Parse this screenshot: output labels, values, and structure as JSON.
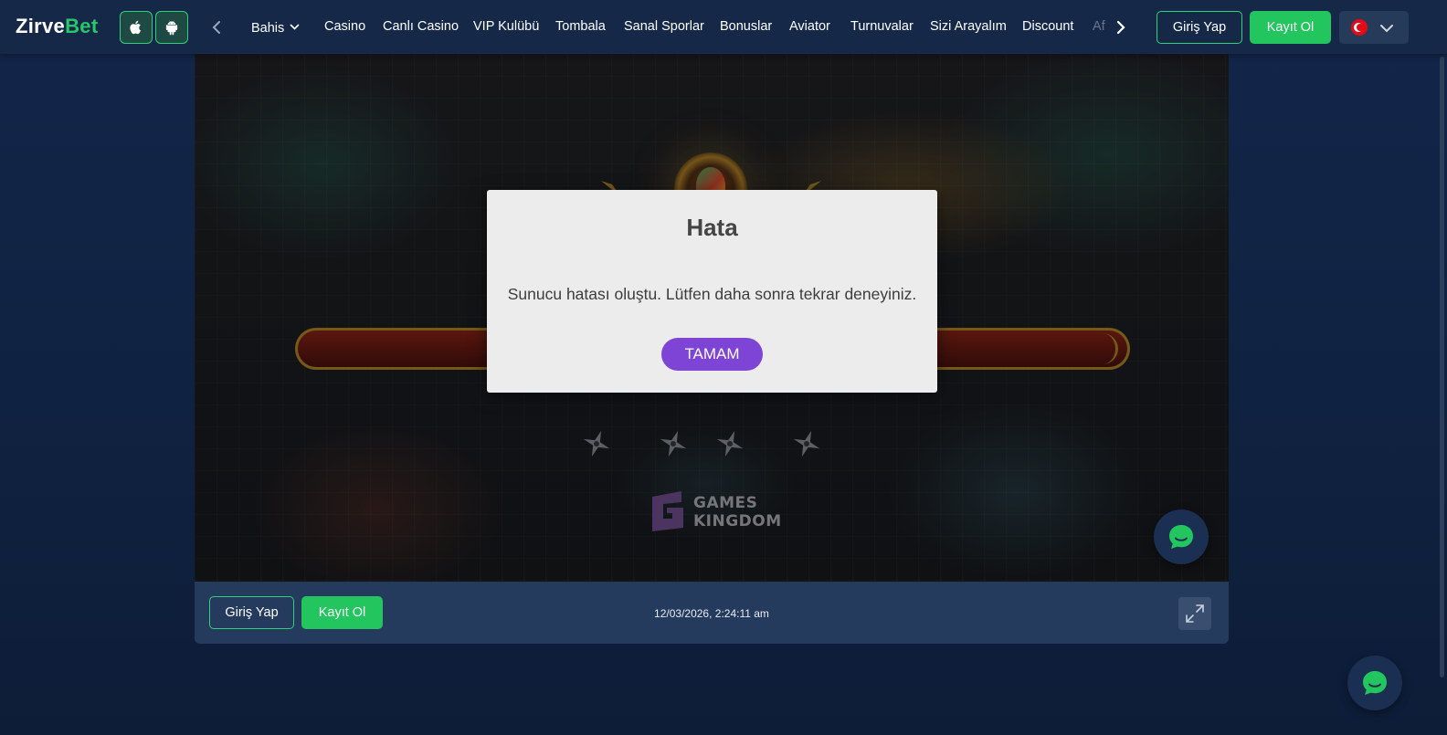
{
  "header": {
    "logo_part1": "Zirve",
    "logo_part2": "Bet",
    "nav_items": [
      {
        "label": "Bahis"
      },
      {
        "label": "Casino"
      },
      {
        "label": "Canlı Casino"
      },
      {
        "label": "VIP Kulübü"
      },
      {
        "label": "Tombala"
      },
      {
        "label": "Sanal Sporlar"
      },
      {
        "label": "Bonuslar"
      },
      {
        "label": "Aviator"
      },
      {
        "label": "Turnuvalar"
      },
      {
        "label": "Sizi Arayalım"
      },
      {
        "label": "Discount"
      },
      {
        "label": "Af"
      }
    ],
    "login_label": "Giriş Yap",
    "register_label": "Kayıt Ol",
    "language_flag": "turkey-flag-icon"
  },
  "game": {
    "provider_logo_text": "GAMES\nKINGDOM"
  },
  "dialog": {
    "title": "Hata",
    "message": "Sunucu hatası oluştu. Lütfen daha sonra tekrar deneyiniz.",
    "ok_label": "TAMAM"
  },
  "game_bar": {
    "login_label": "Giriş Yap",
    "register_label": "Kayıt Ol",
    "timestamp": "12/03/2026, 2:24:11 am"
  },
  "colors": {
    "accent_green": "#22c55e",
    "dialog_button": "#7d44d6",
    "header_bg": "#152848",
    "page_bg": "#12264a"
  }
}
